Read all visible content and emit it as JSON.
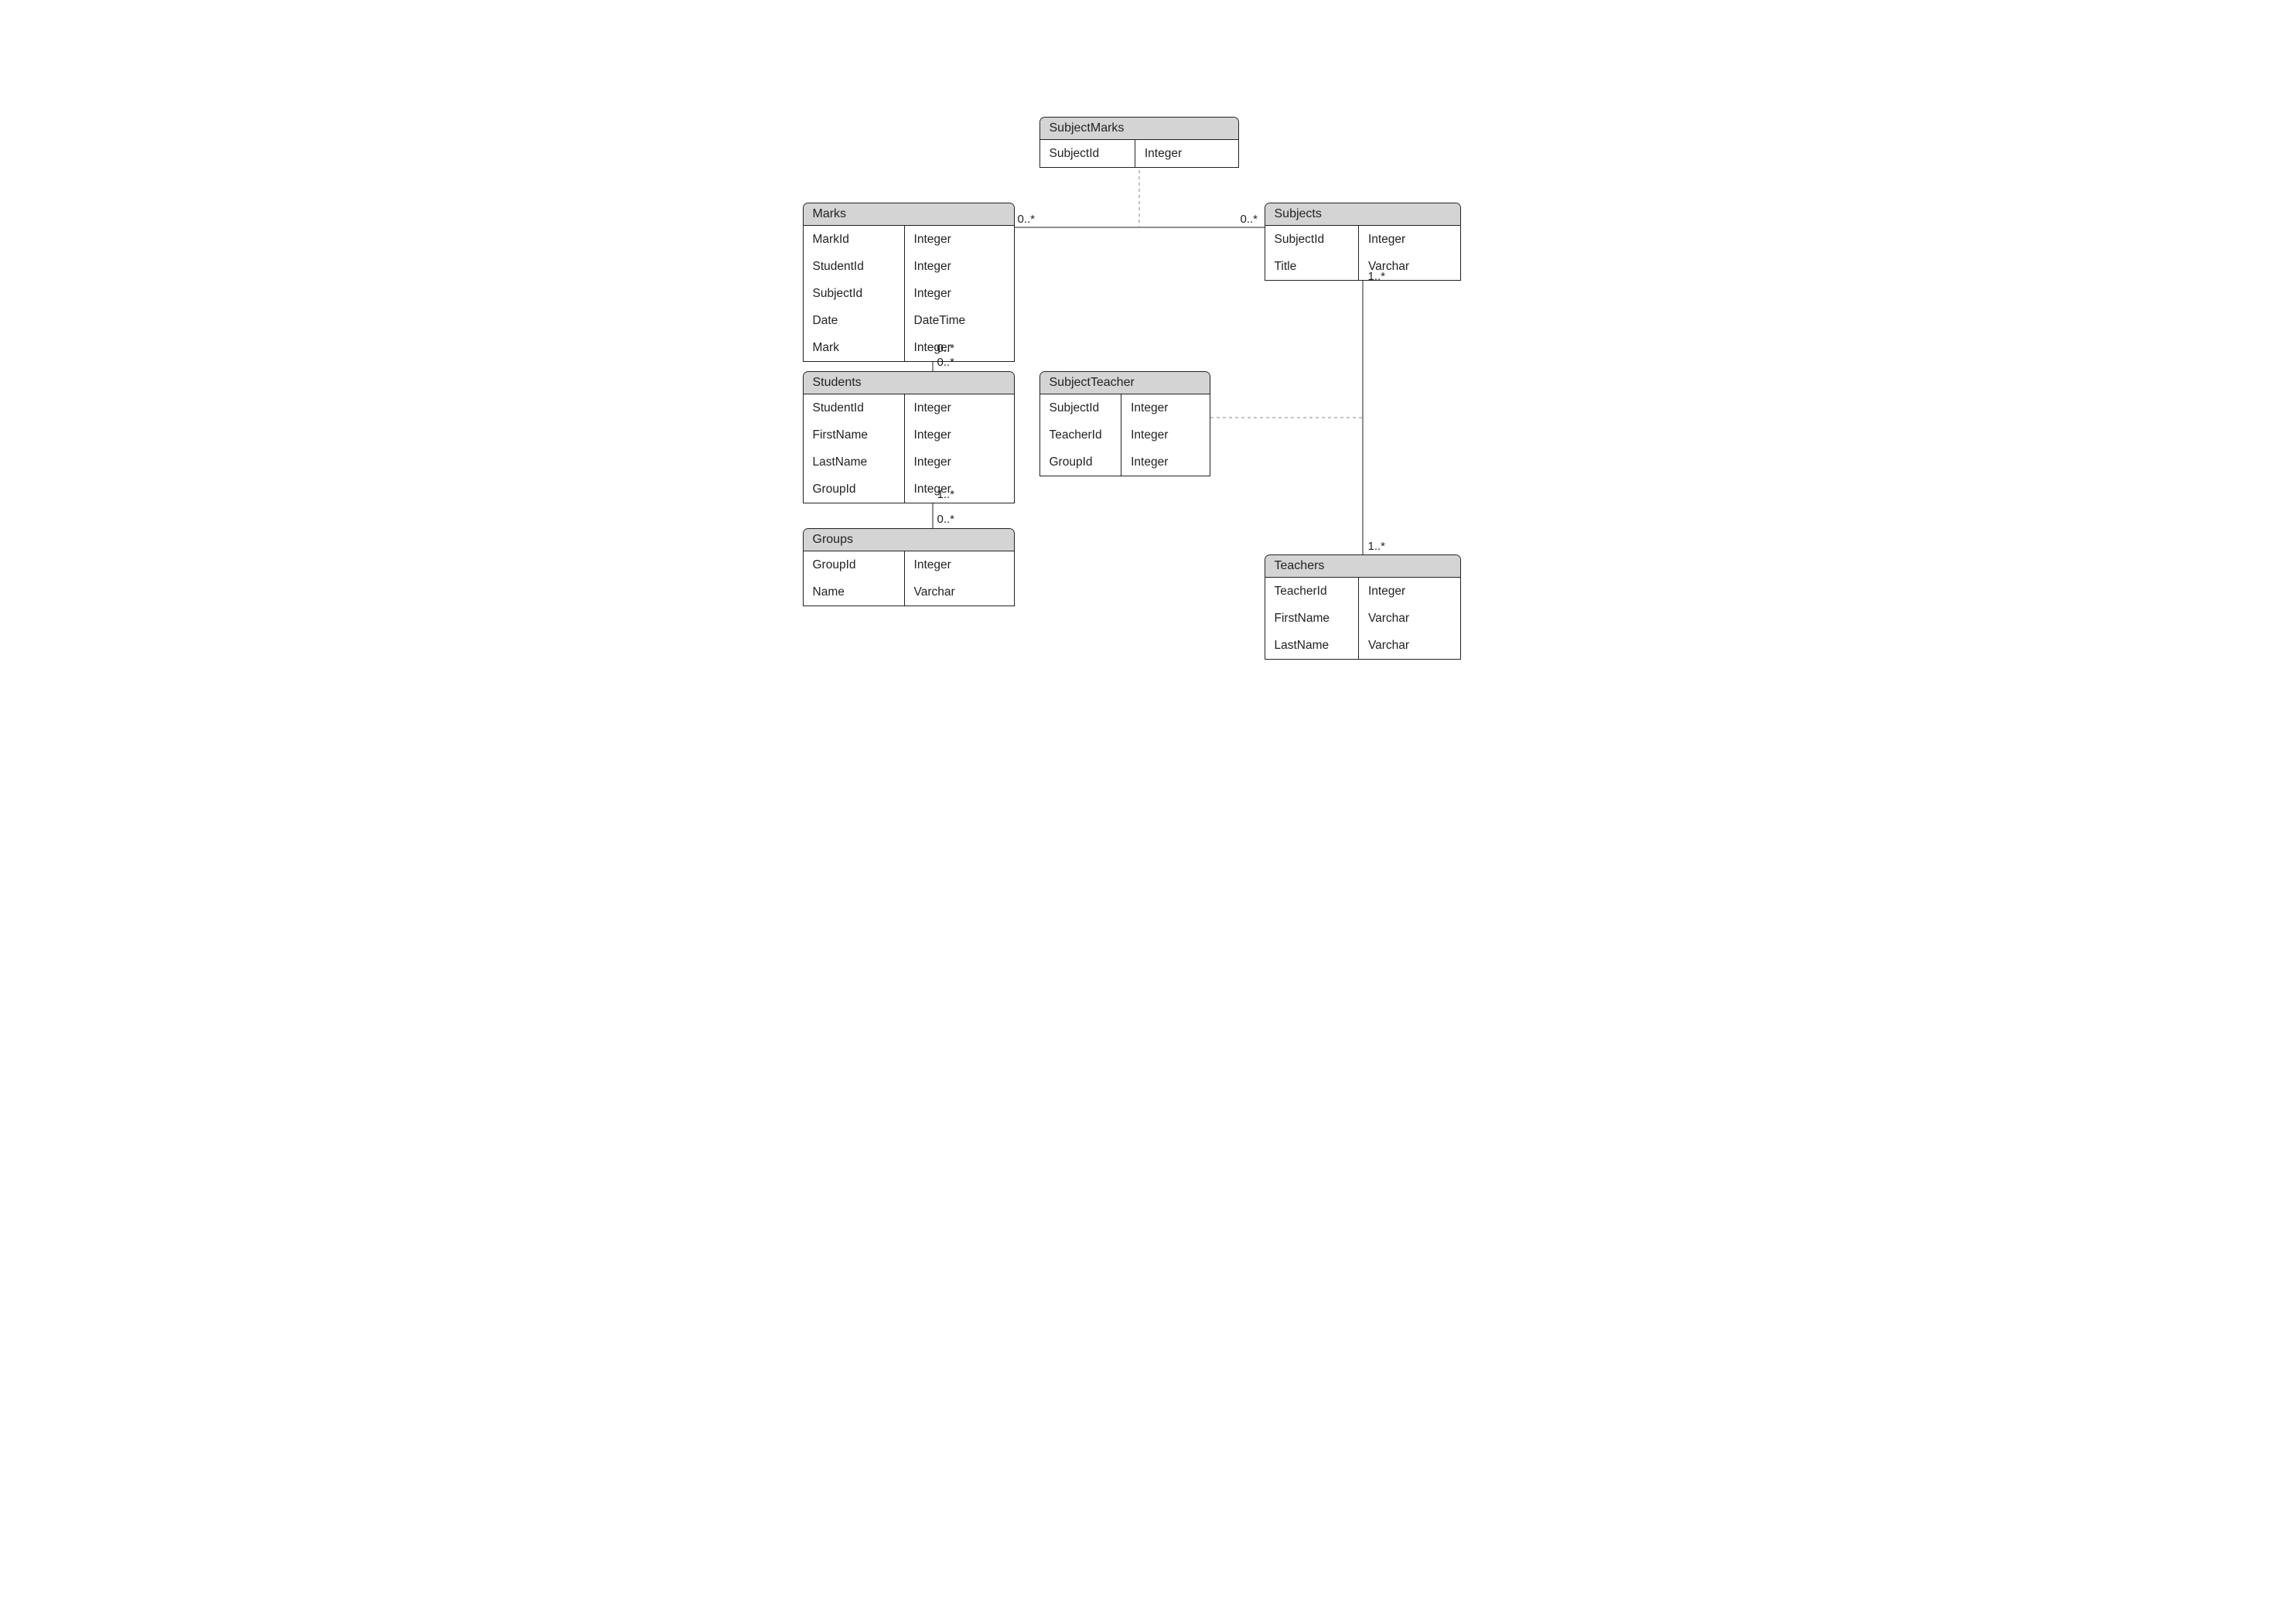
{
  "entities": {
    "subjectMarks": {
      "title": "SubjectMarks",
      "fields": [
        {
          "name": "SubjectId",
          "type": "Integer"
        }
      ]
    },
    "marks": {
      "title": "Marks",
      "fields": [
        {
          "name": "MarkId",
          "type": "Integer"
        },
        {
          "name": "StudentId",
          "type": "Integer"
        },
        {
          "name": "SubjectId",
          "type": "Integer"
        },
        {
          "name": "Date",
          "type": "DateTime"
        },
        {
          "name": "Mark",
          "type": "Integer"
        }
      ]
    },
    "subjects": {
      "title": "Subjects",
      "fields": [
        {
          "name": "SubjectId",
          "type": "Integer"
        },
        {
          "name": "Title",
          "type": "Varchar"
        }
      ]
    },
    "students": {
      "title": "Students",
      "fields": [
        {
          "name": "StudentId",
          "type": "Integer"
        },
        {
          "name": "FirstName",
          "type": "Integer"
        },
        {
          "name": "LastName",
          "type": "Integer"
        },
        {
          "name": "GroupId",
          "type": "Integer"
        }
      ]
    },
    "subjectTeacher": {
      "title": "SubjectTeacher",
      "fields": [
        {
          "name": "SubjectId",
          "type": "Integer"
        },
        {
          "name": "TeacherId",
          "type": "Integer"
        },
        {
          "name": "GroupId",
          "type": "Integer"
        }
      ]
    },
    "groups": {
      "title": "Groups",
      "fields": [
        {
          "name": "GroupId",
          "type": "Integer"
        },
        {
          "name": "Name",
          "type": "Varchar"
        }
      ]
    },
    "teachers": {
      "title": "Teachers",
      "fields": [
        {
          "name": "TeacherId",
          "type": "Integer"
        },
        {
          "name": "FirstName",
          "type": "Varchar"
        },
        {
          "name": "LastName",
          "type": "Varchar"
        }
      ]
    }
  },
  "mults": {
    "marksSubjects_left": "0..*",
    "marksSubjects_right": "0..*",
    "subjectsTeachers_top": "1..*",
    "subjectsTeachers_bottom": "1..*",
    "marks_bottom": "0..*",
    "students_top": "0..*",
    "students_bottom": "1..*",
    "groups_top": "0..*"
  }
}
